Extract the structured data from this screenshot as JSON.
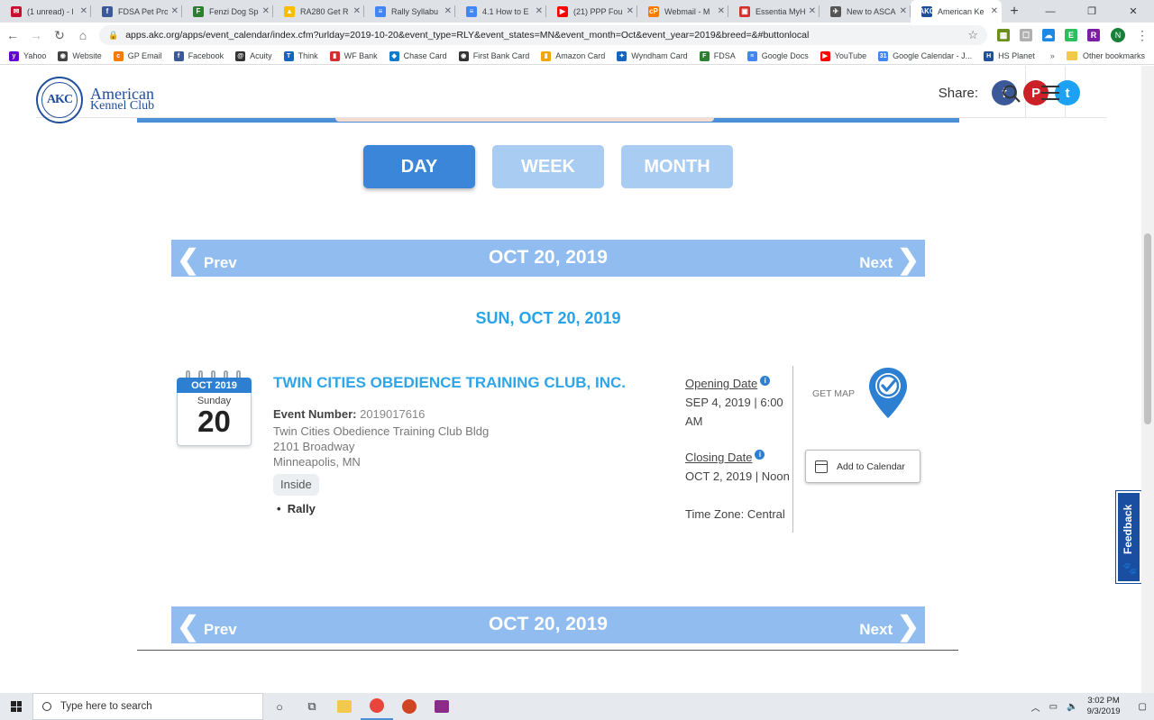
{
  "browser": {
    "tabs": [
      {
        "title": "(1 unread) - l",
        "color": "#c8102e",
        "glyph": "✉"
      },
      {
        "title": "FDSA Pet Pro",
        "color": "#3b5998",
        "glyph": "f"
      },
      {
        "title": "Fenzi Dog Sp",
        "color": "#2e7d32",
        "glyph": "F"
      },
      {
        "title": "RA280 Get R",
        "color": "#fbbc04",
        "glyph": "▲"
      },
      {
        "title": "Rally Syllabu",
        "color": "#4285f4",
        "glyph": "≡"
      },
      {
        "title": "4.1 How to E",
        "color": "#4285f4",
        "glyph": "≡"
      },
      {
        "title": "(21) PPP Fou",
        "color": "#ff0000",
        "glyph": "▶"
      },
      {
        "title": "Webmail - M",
        "color": "#f57c00",
        "glyph": "cP"
      },
      {
        "title": "Essentia MyH",
        "color": "#d32f2f",
        "glyph": "▣"
      },
      {
        "title": "New to ASCA",
        "color": "#555555",
        "glyph": "✈"
      },
      {
        "title": "American Ke",
        "color": "#1f4e9a",
        "glyph": "AKC"
      }
    ],
    "new_tab": "+",
    "url": "apps.akc.org/apps/event_calendar/index.cfm?urlday=2019-10-20&event_type=RLY&event_states=MN&event_month=Oct&event_year=2019&breed=&#buttonlocal",
    "profile_initial": "N",
    "extensions": [
      {
        "name": "ext-green",
        "color": "#6a8f1c",
        "glyph": "▦"
      },
      {
        "name": "ext-gray",
        "color": "#b0b0b0",
        "glyph": "☐"
      },
      {
        "name": "ext-cloud",
        "color": "#1e88e5",
        "glyph": "☁"
      },
      {
        "name": "ext-evernote",
        "color": "#2dbe60",
        "glyph": "E"
      },
      {
        "name": "ext-r",
        "color": "#7b1fa2",
        "glyph": "R"
      }
    ],
    "bookmarks": [
      {
        "label": "Yahoo",
        "color": "#6001d2",
        "glyph": "y"
      },
      {
        "label": "Website",
        "color": "#444444",
        "glyph": "◉"
      },
      {
        "label": "GP Email",
        "color": "#f57c00",
        "glyph": "c"
      },
      {
        "label": "Facebook",
        "color": "#3b5998",
        "glyph": "f"
      },
      {
        "label": "Acuity",
        "color": "#333333",
        "glyph": "@"
      },
      {
        "label": "Think",
        "color": "#1565c0",
        "glyph": "T"
      },
      {
        "label": "WF Bank",
        "color": "#d32f2f",
        "glyph": "▮"
      },
      {
        "label": "Chase Card",
        "color": "#117aca",
        "glyph": "◆"
      },
      {
        "label": "First Bank Card",
        "color": "#333333",
        "glyph": "◉"
      },
      {
        "label": "Amazon Card",
        "color": "#f2a600",
        "glyph": "▮"
      },
      {
        "label": "Wyndham Card",
        "color": "#1565c0",
        "glyph": "✦"
      },
      {
        "label": "FDSA",
        "color": "#2e7d32",
        "glyph": "F"
      },
      {
        "label": "Google Docs",
        "color": "#4285f4",
        "glyph": "≡"
      },
      {
        "label": "YouTube",
        "color": "#ff0000",
        "glyph": "▶"
      },
      {
        "label": "Google Calendar - J...",
        "color": "#4285f4",
        "glyph": "31"
      },
      {
        "label": "HS Planet",
        "color": "#1f4e9a",
        "glyph": "H"
      }
    ],
    "bookmarks_more": "»",
    "other_bookmarks": "Other bookmarks"
  },
  "akc": {
    "logo_seal": "AKC",
    "logo_line1": "American",
    "logo_line2": "Kennel Club",
    "share_label": "Share:",
    "social": [
      {
        "name": "facebook",
        "color": "#3b5998",
        "glyph": "f"
      },
      {
        "name": "pinterest",
        "color": "#cb2027",
        "glyph": "P"
      },
      {
        "name": "twitter",
        "color": "#1da1f2",
        "glyph": "t"
      }
    ]
  },
  "view_tabs": [
    {
      "label": "DAY",
      "state": "active"
    },
    {
      "label": "WEEK",
      "state": "inactive"
    },
    {
      "label": "MONTH",
      "state": "inactive"
    }
  ],
  "date_nav": {
    "prev": "Prev",
    "next": "Next",
    "date": "OCT 20, 2019"
  },
  "day_heading": "SUN, OCT 20, 2019",
  "event": {
    "cal_month": "OCT 2019",
    "cal_dow": "Sunday",
    "cal_day": "20",
    "club": "TWIN CITIES OBEDIENCE TRAINING CLUB, INC.",
    "event_number_label": "Event Number:",
    "event_number": "2019017616",
    "address": [
      "Twin Cities Obedience Training Club Bldg",
      "2101 Broadway",
      "Minneapolis, MN"
    ],
    "location_type": "Inside",
    "competitions": [
      "Rally"
    ],
    "opening_label": "Opening Date",
    "opening_value": "SEP 4, 2019 | 6:00 AM",
    "closing_label": "Closing Date",
    "closing_value": "OCT 2, 2019 | Noon",
    "timezone": "Time Zone: Central",
    "info_glyph": "i",
    "get_map": "GET MAP",
    "add_calendar": "Add to Calendar"
  },
  "feedback": {
    "label": "Feedback",
    "paw": "🐾"
  },
  "taskbar": {
    "search_placeholder": "Type here to search",
    "time": "3:02 PM",
    "date": "9/3/2019"
  }
}
